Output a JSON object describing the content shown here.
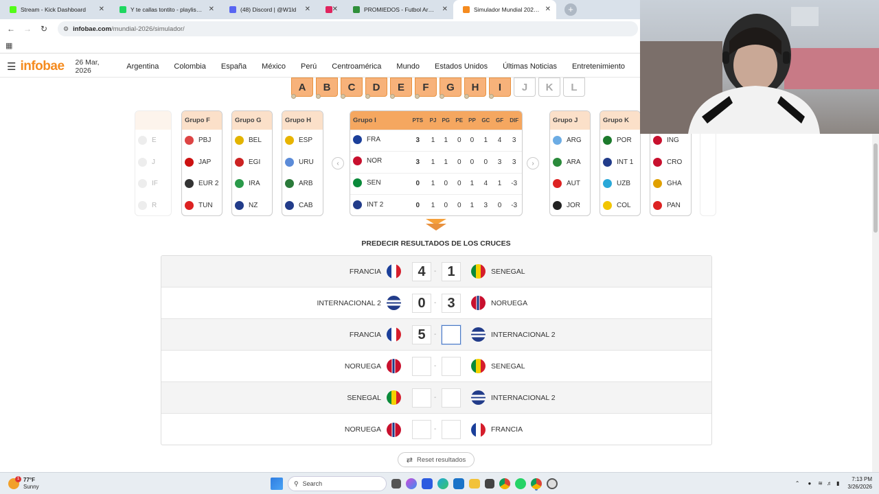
{
  "browser": {
    "tabs": [
      {
        "title": "Stream - Kick Dashboard",
        "color": "#53fc18"
      },
      {
        "title": "Y te callas tontito - playlist by ...",
        "color": "#1ed760"
      },
      {
        "title": "(48) Discord | @W1ld",
        "color": "#5865f2"
      },
      {
        "title": "",
        "color": "#e0245e"
      },
      {
        "title": "PROMIEDOS - Futbol Argentino",
        "color": "#2f8f3a"
      },
      {
        "title": "Simulador Mundial 2026: armá ...",
        "color": "#f58b1f",
        "active": true
      }
    ],
    "url_domain": "infobae.com",
    "url_path": "/mundial-2026/simulador/"
  },
  "site": {
    "logo": "infobae",
    "date": "26 Mar, 2026",
    "nav": [
      "Argentina",
      "Colombia",
      "España",
      "México",
      "Perú",
      "Centroamérica",
      "Mundo",
      "Estados Unidos",
      "Últimas Noticias",
      "Entretenimiento"
    ]
  },
  "group_letters": [
    {
      "l": "A",
      "on": true
    },
    {
      "l": "B",
      "on": true
    },
    {
      "l": "C",
      "on": true
    },
    {
      "l": "D",
      "on": true
    },
    {
      "l": "E",
      "on": true
    },
    {
      "l": "F",
      "on": true
    },
    {
      "l": "G",
      "on": true
    },
    {
      "l": "H",
      "on": true
    },
    {
      "l": "I",
      "on": true
    },
    {
      "l": "J",
      "on": false
    },
    {
      "l": "K",
      "on": false
    },
    {
      "l": "L",
      "on": false
    }
  ],
  "groups_left": [
    {
      "name": "",
      "teams": [
        {
          "code": "E",
          "c": "#ccc"
        },
        {
          "code": "J",
          "c": "#ccc"
        },
        {
          "code": "IF",
          "c": "#ccc"
        },
        {
          "code": "R",
          "c": "#ccc"
        }
      ]
    },
    {
      "name": "Grupo F",
      "teams": [
        {
          "code": "PBJ",
          "c": "#d44"
        },
        {
          "code": "JAP",
          "c": "#c11"
        },
        {
          "code": "EUR 2",
          "c": "#333"
        },
        {
          "code": "TUN",
          "c": "#d22"
        }
      ]
    },
    {
      "name": "Grupo G",
      "teams": [
        {
          "code": "BEL",
          "c": "#e3b400"
        },
        {
          "code": "EGI",
          "c": "#c22"
        },
        {
          "code": "IRA",
          "c": "#2a9a4a"
        },
        {
          "code": "NZ",
          "c": "#223c8a"
        }
      ]
    },
    {
      "name": "Grupo H",
      "teams": [
        {
          "code": "ESP",
          "c": "#e8b400"
        },
        {
          "code": "URU",
          "c": "#5b8bd8"
        },
        {
          "code": "ARB",
          "c": "#2a7a3a"
        },
        {
          "code": "CAB",
          "c": "#223c8a"
        }
      ]
    }
  ],
  "main_group": {
    "name": "Grupo I",
    "cols": [
      "PTS",
      "PJ",
      "PG",
      "PE",
      "PP",
      "GC",
      "GF",
      "DIF"
    ],
    "rows": [
      {
        "team": "FRA",
        "flag": "#1b3f9a",
        "vals": [
          "3",
          "1",
          "1",
          "0",
          "0",
          "1",
          "4",
          "3"
        ]
      },
      {
        "team": "NOR",
        "flag": "#c8102e",
        "vals": [
          "3",
          "1",
          "1",
          "0",
          "0",
          "0",
          "3",
          "3"
        ]
      },
      {
        "team": "SEN",
        "flag": "#0a8a3a",
        "vals": [
          "0",
          "1",
          "0",
          "0",
          "1",
          "4",
          "1",
          "-3"
        ]
      },
      {
        "team": "INT 2",
        "flag": "#223c8a",
        "vals": [
          "0",
          "1",
          "0",
          "0",
          "1",
          "3",
          "0",
          "-3"
        ]
      }
    ]
  },
  "groups_right": [
    {
      "name": "Grupo J",
      "teams": [
        {
          "code": "ARG",
          "c": "#6cace4"
        },
        {
          "code": "ARA",
          "c": "#2a8a3a"
        },
        {
          "code": "AUT",
          "c": "#d22"
        },
        {
          "code": "JOR",
          "c": "#222"
        }
      ]
    },
    {
      "name": "Grupo K",
      "teams": [
        {
          "code": "POR",
          "c": "#1c7a2c"
        },
        {
          "code": "INT 1",
          "c": "#223c8a"
        },
        {
          "code": "UZB",
          "c": "#2aa8d8"
        },
        {
          "code": "COL",
          "c": "#f2c500"
        }
      ]
    },
    {
      "name": "",
      "teams": [
        {
          "code": "ING",
          "c": "#c8102e"
        },
        {
          "code": "CRO",
          "c": "#c8102e"
        },
        {
          "code": "GHA",
          "c": "#e0a000"
        },
        {
          "code": "PAN",
          "c": "#d22"
        }
      ]
    }
  ],
  "predict_title": "PREDECIR RESULTADOS DE LOS CRUCES",
  "matches": [
    {
      "home": "FRANCIA",
      "hf": "fr",
      "away": "SENEGAL",
      "af": "sn",
      "hs": "4",
      "as": "1"
    },
    {
      "home": "INTERNACIONAL 2",
      "hf": "int",
      "away": "NORUEGA",
      "af": "no",
      "hs": "0",
      "as": "3"
    },
    {
      "home": "FRANCIA",
      "hf": "fr",
      "away": "INTERNACIONAL 2",
      "af": "int",
      "hs": "5",
      "as": "",
      "focus": true
    },
    {
      "home": "NORUEGA",
      "hf": "no",
      "away": "SENEGAL",
      "af": "sn",
      "hs": "",
      "as": ""
    },
    {
      "home": "SENEGAL",
      "hf": "sn",
      "away": "INTERNACIONAL 2",
      "af": "int",
      "hs": "",
      "as": ""
    },
    {
      "home": "NORUEGA",
      "hf": "no",
      "away": "FRANCIA",
      "af": "fr",
      "hs": "",
      "as": ""
    }
  ],
  "reset_label": "Reset resultados",
  "taskbar": {
    "temp": "77°F",
    "weather": "Sunny",
    "search": "Search",
    "time": "7:13 PM",
    "date": "3/26/2026",
    "badge": "1"
  }
}
